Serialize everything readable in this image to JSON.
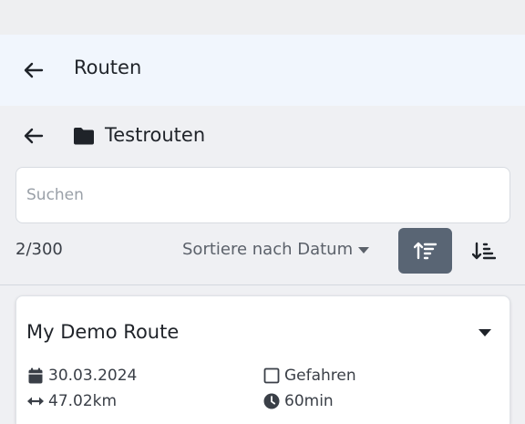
{
  "appbar": {
    "title": "Routen"
  },
  "folder": {
    "name": "Testrouten"
  },
  "search": {
    "placeholder": "Suchen",
    "value": ""
  },
  "toolbar": {
    "count": "2/300",
    "sort_label": "Sortiere nach Datum"
  },
  "routes": [
    {
      "name": "My Demo Route",
      "date": "30.03.2024",
      "driven_label": "Gefahren",
      "driven_checked": false,
      "distance": "47.02km",
      "duration": "60min"
    }
  ],
  "icons": {
    "back": "arrow-left-icon",
    "folder": "folder-icon",
    "sort_desc": "sort-descending-icon",
    "sort_asc": "sort-ascending-icon",
    "calendar": "calendar-icon",
    "checkbox": "checkbox-icon",
    "distance": "arrows-horizontal-icon",
    "clock": "clock-icon"
  },
  "colors": {
    "active_sort_button": "#596574"
  }
}
